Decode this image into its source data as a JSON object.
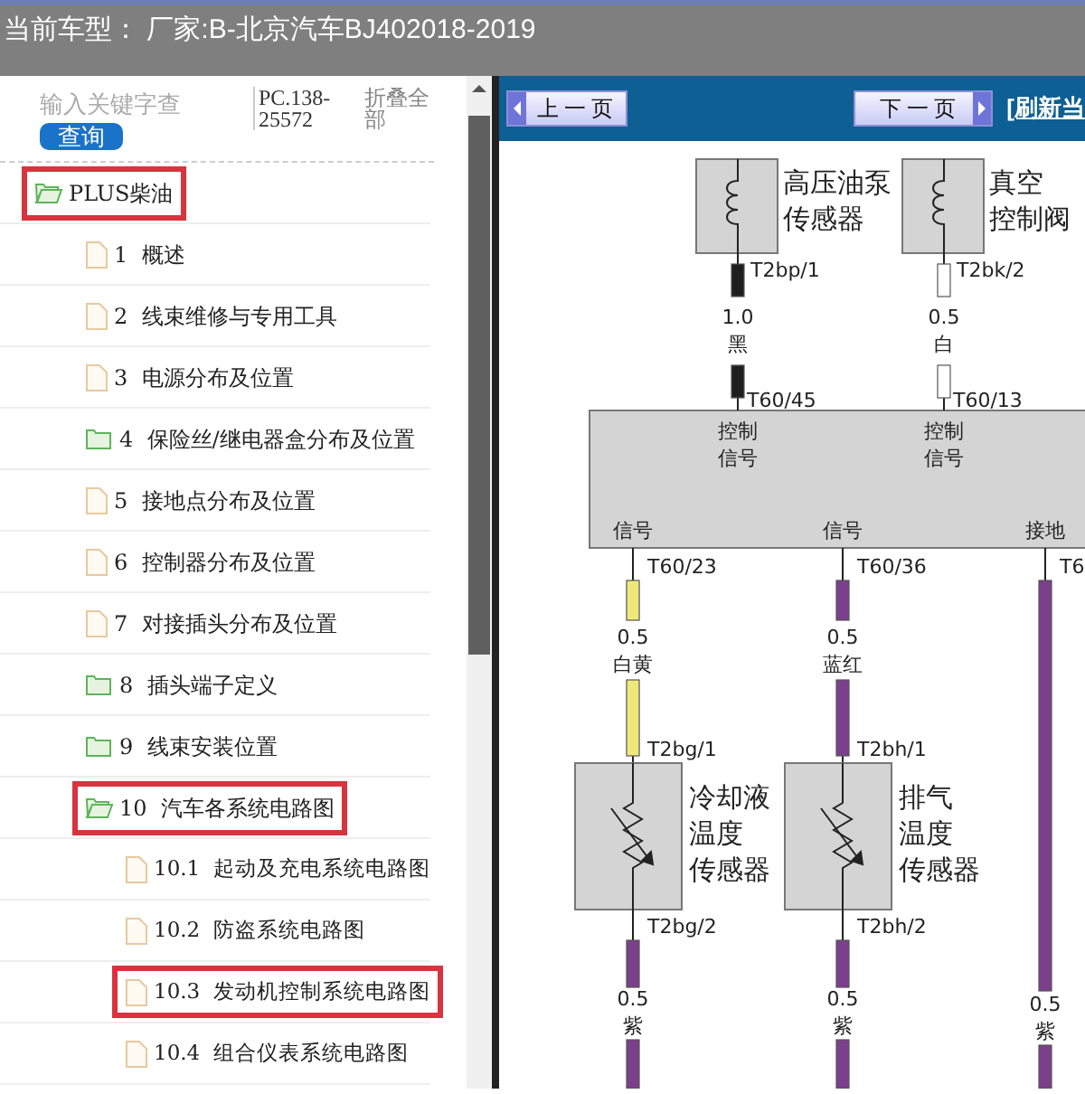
{
  "title_bar": {
    "text": "当前车型：  厂家:B-北京汽车BJ402018-2019"
  },
  "sidebar": {
    "search": {
      "placeholder": "输入关键字查"
    },
    "search_button": "查询",
    "code": "PC.138-25572",
    "collapse_link": "折叠全部",
    "tree": [
      {
        "label": "PLUS柴油",
        "kind": "folder",
        "expanded": true,
        "highlighted": true,
        "children": [
          {
            "label": "1  概述",
            "kind": "file",
            "highlighted": false
          },
          {
            "label": "2  线束维修与专用工具",
            "kind": "file",
            "highlighted": false
          },
          {
            "label": "3  电源分布及位置",
            "kind": "file",
            "highlighted": false
          },
          {
            "label": "4  保险丝/继电器盒分布及位置",
            "kind": "folder",
            "expanded": false,
            "highlighted": false
          },
          {
            "label": "5  接地点分布及位置",
            "kind": "file",
            "highlighted": false
          },
          {
            "label": "6  控制器分布及位置",
            "kind": "file",
            "highlighted": false
          },
          {
            "label": "7  对接插头分布及位置",
            "kind": "file",
            "highlighted": false
          },
          {
            "label": "8  插头端子定义",
            "kind": "folder",
            "expanded": false,
            "highlighted": false
          },
          {
            "label": "9  线束安装位置",
            "kind": "folder",
            "expanded": false,
            "highlighted": false
          },
          {
            "label": "10  汽车各系统电路图",
            "kind": "folder",
            "expanded": true,
            "highlighted": true,
            "children": [
              {
                "label": "10.1  起动及充电系统电路图",
                "kind": "file",
                "highlighted": false
              },
              {
                "label": "10.2  防盗系统电路图",
                "kind": "file",
                "highlighted": false
              },
              {
                "label": "10.3  发动机控制系统电路图",
                "kind": "file",
                "highlighted": true
              },
              {
                "label": "10.4  组合仪表系统电路图",
                "kind": "file",
                "highlighted": false
              }
            ]
          }
        ]
      }
    ]
  },
  "toolbar": {
    "prev_button": "上一页",
    "next_button": "下一页",
    "refresh_link": "[刷新当"
  },
  "diagram": {
    "upper_components": [
      {
        "kind": "coil",
        "label_lines": [
          "高压油泵",
          "传感器"
        ],
        "pin": "T2bp/1",
        "gauge": "1.0",
        "wire_color_name": "黑",
        "color": "#1e1e1e",
        "ecu_pin": "T60/45",
        "ecu_label_lines": [
          "控制",
          "信号"
        ]
      },
      {
        "kind": "coil",
        "label_lines": [
          "真空",
          "控制阀"
        ],
        "pin": "T2bk/2",
        "gauge": "0.5",
        "wire_color_name": "白",
        "color": "#ffffff",
        "ecu_pin": "T60/13",
        "ecu_label_lines": [
          "控制",
          "信号"
        ]
      }
    ],
    "lower_wires": [
      {
        "kind": "sensor",
        "ecu_label": "信号",
        "ecu_pin": "T60/23",
        "gauge": "0.5",
        "wire_color_name": "白黄",
        "color": "#efe97a",
        "sensor_pin_top": "T2bg/1",
        "label_lines": [
          "冷却液",
          "温度",
          "传感器"
        ],
        "sensor_pin_bottom": "T2bg/2",
        "lower_wire": {
          "gauge": "0.5",
          "wire_color_name": "紫",
          "color": "#7b3f8c"
        }
      },
      {
        "kind": "sensor",
        "ecu_label": "信号",
        "ecu_pin": "T60/36",
        "gauge": "0.5",
        "wire_color_name": "蓝红",
        "color": "#7b3f8c",
        "sensor_pin_top": "T2bh/1",
        "label_lines": [
          "排气",
          "温度",
          "传感器"
        ],
        "sensor_pin_bottom": "T2bh/2",
        "lower_wire": {
          "gauge": "0.5",
          "wire_color_name": "紫",
          "color": "#7b3f8c"
        }
      },
      {
        "kind": "ground",
        "ecu_label": "接地",
        "ecu_pin": "T6",
        "gauge": "0.5",
        "wire_color_name": "紫",
        "color": "#7b3f8c"
      }
    ]
  }
}
